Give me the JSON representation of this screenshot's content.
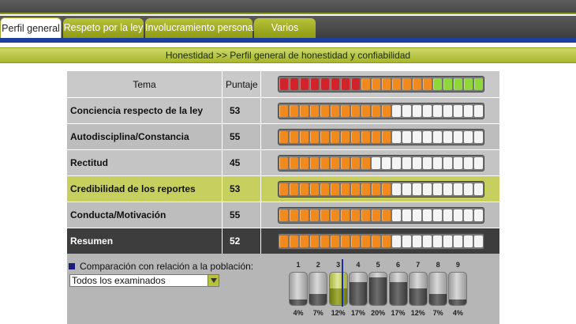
{
  "tabs": [
    {
      "label": "Perfil general",
      "active": true
    },
    {
      "label": "Respeto por la ley",
      "active": false
    },
    {
      "label": "Involucramiento personal",
      "active": false
    },
    {
      "label": "Varios",
      "active": false
    }
  ],
  "breadcrumb": "Honestidad >> Perfil general de honestidad y confiabilidad",
  "table": {
    "header_topic": "Tema",
    "header_score": "Puntaje",
    "scale_colors": [
      "#d2232a",
      "#f08a1e",
      "#8fd63a"
    ],
    "rows": [
      {
        "topic": "Conciencia respecto de la ley",
        "score": "53",
        "level": 53,
        "style": "alt"
      },
      {
        "topic": "Autodisciplina/Constancia",
        "score": "55",
        "level": 55,
        "style": "norm"
      },
      {
        "topic": "Rectitud",
        "score": "45",
        "level": 45,
        "style": "alt"
      },
      {
        "topic": "Credibilidad de los reportes",
        "score": "53",
        "level": 53,
        "style": "hl"
      },
      {
        "topic": "Conducta/Motivación",
        "score": "55",
        "level": 55,
        "style": "norm"
      },
      {
        "topic": "Resumen",
        "score": "52",
        "level": 52,
        "style": "dark"
      }
    ]
  },
  "comparison": {
    "label": "Comparación con relación a la población:",
    "select_value": "Todos los examinados",
    "groups": [
      "1",
      "2",
      "3",
      "4",
      "5",
      "6",
      "7",
      "8",
      "9"
    ],
    "percents": [
      "4%",
      "7%",
      "12%",
      "17%",
      "20%",
      "17%",
      "12%",
      "7%",
      "4%"
    ],
    "highlighted_group": 3,
    "marker_group": 3
  }
}
